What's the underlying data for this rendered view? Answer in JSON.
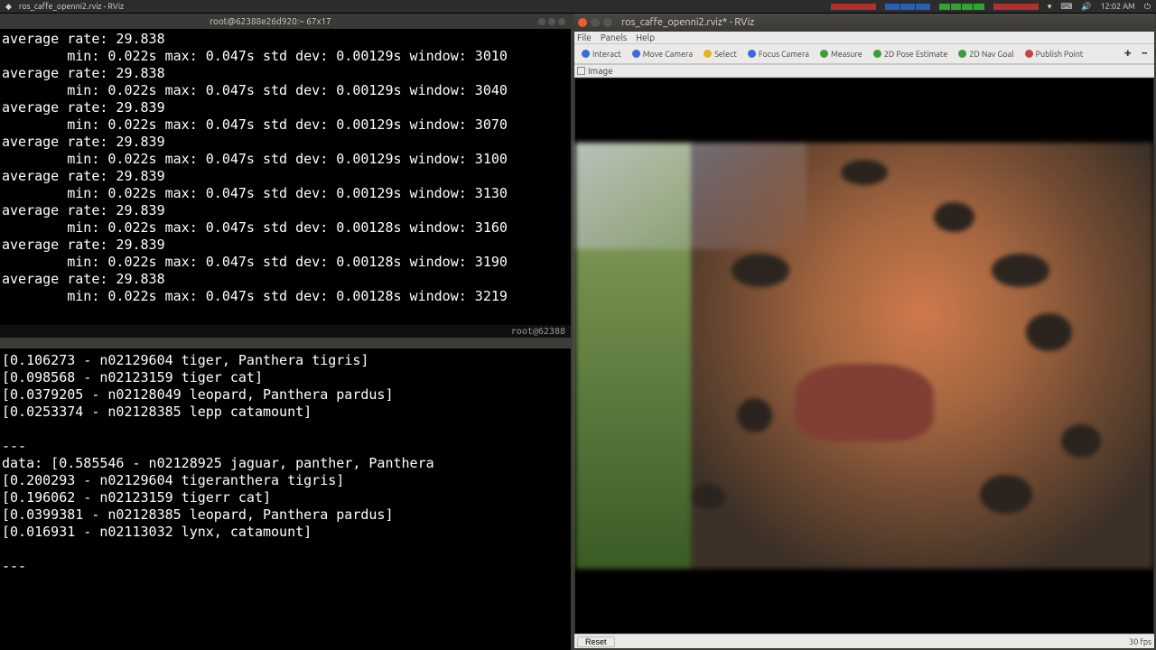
{
  "topbar": {
    "left_title": "ros_caffe_openni2.rviz - RViz",
    "clock": "12:02 AM",
    "icons": [
      "network-icon",
      "volume-icon",
      "battery-icon",
      "power-icon"
    ]
  },
  "term1": {
    "title": "root@62388e26d920:~ 67x17",
    "footer_left": "",
    "footer_right": "root@62388",
    "lines": [
      "average rate: 29.838",
      "        min: 0.022s max: 0.047s std dev: 0.00129s window: 3010",
      "average rate: 29.838",
      "        min: 0.022s max: 0.047s std dev: 0.00129s window: 3040",
      "average rate: 29.839",
      "        min: 0.022s max: 0.047s std dev: 0.00129s window: 3070",
      "average rate: 29.839",
      "        min: 0.022s max: 0.047s std dev: 0.00129s window: 3100",
      "average rate: 29.839",
      "        min: 0.022s max: 0.047s std dev: 0.00129s window: 3130",
      "average rate: 29.839",
      "        min: 0.022s max: 0.047s std dev: 0.00128s window: 3160",
      "average rate: 29.839",
      "        min: 0.022s max: 0.047s std dev: 0.00128s window: 3190",
      "average rate: 29.838",
      "        min: 0.022s max: 0.047s std dev: 0.00128s window: 3219",
      ""
    ]
  },
  "term2": {
    "title": "",
    "lines2": [
      "[0.106273 - n02129604 tiger, Panthera tigris]",
      "[0.098568 - n02123159 tiger cat]",
      "[0.0379205 - n02128049 leopard, Panthera pardus]",
      "[0.0253374 - n02128385 lepp catamount]",
      "",
      "---",
      "data: [0.585546 - n02128925 jaguar, panther, Panthera",
      "[0.200293 - n02129604 tigeranthera tigris]",
      "[0.196062 - n02123159 tigerr cat]",
      "[0.0399381 - n02128385 leopard, Panthera pardus]",
      "[0.016931 - n02113032 lynx, catamount]",
      "",
      "---",
      ""
    ]
  },
  "rviz": {
    "window_title": "ros_caffe_openni2.rviz* - RViz",
    "menus": [
      "File",
      "Panels",
      "Help"
    ],
    "tools": [
      {
        "label": "Interact",
        "color": "blue"
      },
      {
        "label": "Move Camera",
        "color": "blue"
      },
      {
        "label": "Select",
        "color": "yellow"
      },
      {
        "label": "Focus Camera",
        "color": "blue"
      },
      {
        "label": "Measure",
        "color": "green"
      },
      {
        "label": "2D Pose Estimate",
        "color": "green"
      },
      {
        "label": "2D Nav Goal",
        "color": "green"
      },
      {
        "label": "Publish Point",
        "color": "red"
      }
    ],
    "panel_header": "Image",
    "status": {
      "reset_label": "Reset",
      "fps": "30 fps"
    },
    "image_subject": "jaguar/leopard face"
  }
}
